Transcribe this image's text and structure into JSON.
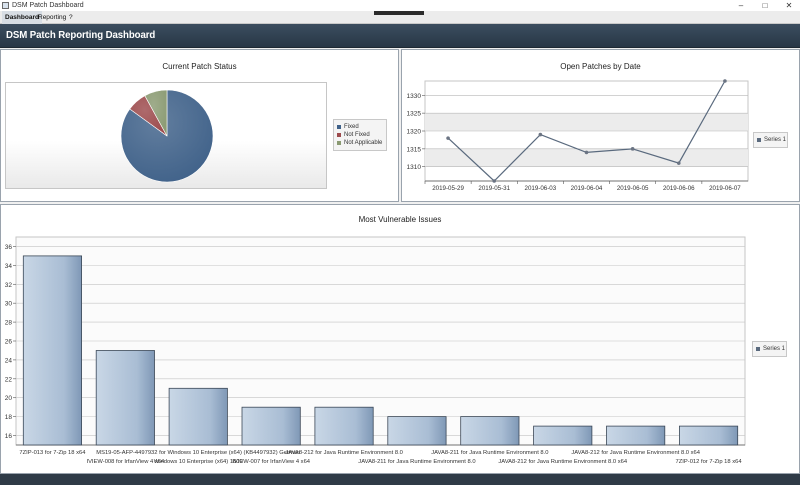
{
  "window": {
    "title": "DSM Patch Dashboard",
    "controls": [
      "–",
      "□",
      "✕"
    ]
  },
  "menu": {
    "items": [
      "Dashboard",
      "Reporting",
      "?"
    ],
    "active_index": 0
  },
  "header": {
    "title": "DSM Patch Reporting Dashboard"
  },
  "colors": {
    "header_bg": "#2e3d4c",
    "fixed": "#3f6189",
    "not_fixed": "#9c4a4c",
    "not_applicable": "#8a9a72",
    "line": "#5a6a7e",
    "bar": "#aec2d8"
  },
  "chart_data": [
    {
      "id": "patch_status",
      "type": "pie",
      "title": "Current Patch Status",
      "labels": [
        "Fixed",
        "Not Fixed",
        "Not Applicable"
      ],
      "values": [
        85,
        7,
        8
      ],
      "colors": [
        "#3f6189",
        "#9c4a4c",
        "#8a9a72"
      ],
      "legend_position": "right"
    },
    {
      "id": "open_patches",
      "type": "line",
      "title": "Open Patches by Date",
      "categories": [
        "2019-05-29",
        "2019-05-31",
        "2019-06-03",
        "2019-06-04",
        "2019-06-05",
        "2019-06-06",
        "2019-06-07"
      ],
      "series": [
        {
          "name": "Series 1",
          "values": [
            1318,
            1306,
            1319,
            1314,
            1315,
            1311,
            1334
          ]
        }
      ],
      "ylim": [
        1306,
        1334
      ],
      "yticks": [
        1310,
        1315,
        1320,
        1325,
        1330
      ],
      "grid": true,
      "legend_position": "right"
    },
    {
      "id": "vulnerable_issues",
      "type": "bar",
      "title": "Most Vulnerable Issues",
      "categories": [
        "7ZIP-013 for 7-Zip 18 x64",
        "IVIEW-008 for IrfanView 4 x64",
        "MS19-05-AFP-4497932 for Windows 10 Enterprise (x64) (KB4497932) German Windows 10 Enterprise (x64) 1809",
        "IVIEW-007 for IrfanView 4 x64",
        "JAVA8-212 for Java Runtime Environment 8.0",
        "JAVA8-211 for Java Runtime Environment 8.0",
        "JAVA8-211 for Java Runtime Environment 8.0",
        "JAVA8-212 for Java Runtime Environment 8.0 x64",
        "JAVA8-212 for Java Runtime Environment 8.0 x64",
        "7ZIP-012 for 7-Zip 18 x64"
      ],
      "category_lines": [
        [
          "7ZIP-013 for 7-Zip 18 x64"
        ],
        [
          "IVIEW-008 for IrfanView 4 x64"
        ],
        [
          "MS19-05-AFP-4497932 for Windows 10 Enterprise (x64) (KB4497932) German",
          "Windows 10 Enterprise (x64) 1809"
        ],
        [
          "IVIEW-007 for IrfanView 4 x64"
        ],
        [
          "JAVA8-212 for Java Runtime Environment 8.0"
        ],
        [
          "JAVA8-211 for Java Runtime Environment 8.0"
        ],
        [
          "JAVA8-211 for Java Runtime Environment 8.0"
        ],
        [
          "JAVA8-212 for Java Runtime Environment 8.0 x64"
        ],
        [
          "JAVA8-212 for Java Runtime Environment 8.0 x64"
        ],
        [
          "7ZIP-012 for 7-Zip 18 x64"
        ]
      ],
      "series": [
        {
          "name": "Series 1",
          "values": [
            35,
            25,
            21,
            19,
            19,
            18,
            18,
            17,
            17,
            17
          ]
        }
      ],
      "ylim": [
        15,
        37
      ],
      "yticks": [
        16,
        18,
        20,
        22,
        24,
        26,
        28,
        30,
        32,
        34,
        36
      ],
      "grid": true,
      "legend_position": "right"
    }
  ]
}
